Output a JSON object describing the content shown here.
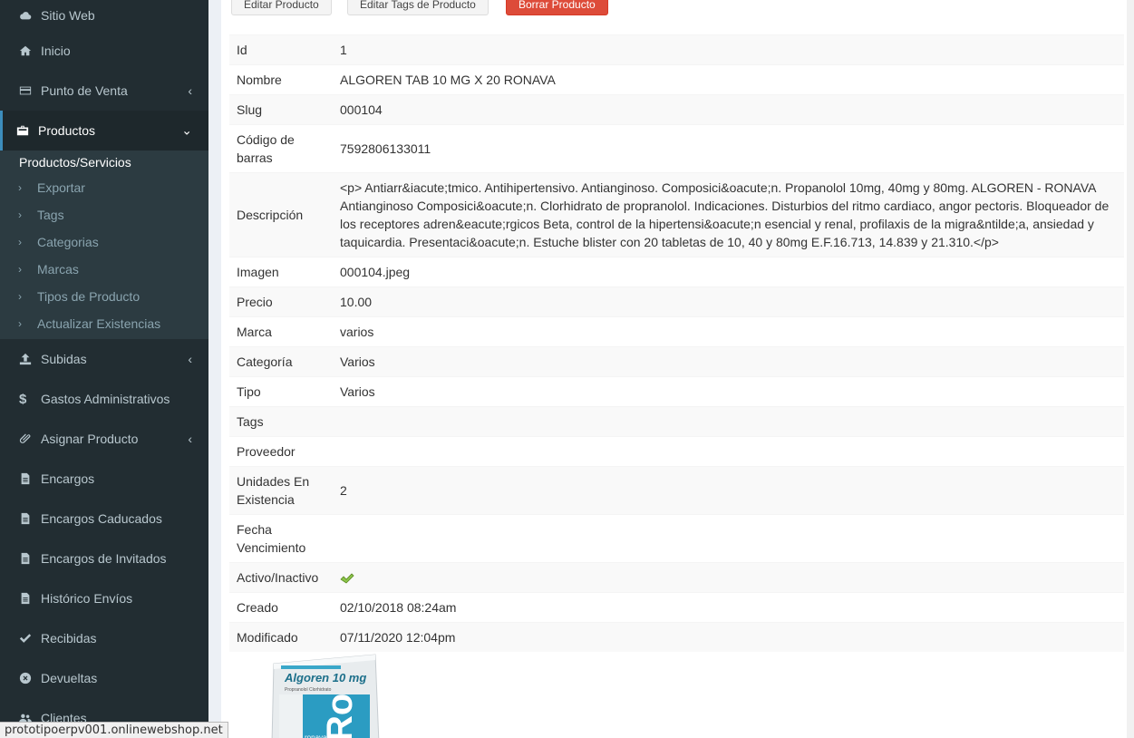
{
  "sidebar": {
    "items": [
      {
        "label": "Sitio Web",
        "icon": "cloud-icon"
      },
      {
        "label": "Inicio",
        "icon": "home-icon"
      },
      {
        "label": "Punto de Venta",
        "icon": "credit-card-icon"
      },
      {
        "label": "Productos",
        "icon": "briefcase-icon"
      },
      {
        "label": "Subidas",
        "icon": "upload-icon"
      },
      {
        "label": "Gastos Administrativos",
        "icon": "dollar-icon"
      },
      {
        "label": "Asignar Producto",
        "icon": "paperclip-icon"
      },
      {
        "label": "Encargos",
        "icon": "file-icon"
      },
      {
        "label": "Encargos Caducados",
        "icon": "file-icon"
      },
      {
        "label": "Encargos de Invitados",
        "icon": "file-icon"
      },
      {
        "label": "Histórico Envíos",
        "icon": "file-icon"
      },
      {
        "label": "Recibidas",
        "icon": "check-icon"
      },
      {
        "label": "Devueltas",
        "icon": "times-circle-icon"
      },
      {
        "label": "Clientes",
        "icon": "users-icon"
      }
    ],
    "submenu": {
      "title": "Productos/Servicios",
      "items": [
        "Exportar",
        "Tags",
        "Categorias",
        "Marcas",
        "Tipos de Producto",
        "Actualizar Existencias"
      ]
    }
  },
  "toolbar": {
    "edit_label": "Editar Producto",
    "edit_tags_label": "Editar Tags de Producto",
    "delete_label": "Borrar Producto"
  },
  "detail": {
    "rows": [
      {
        "key": "Id",
        "value": "1"
      },
      {
        "key": "Nombre",
        "value": "ALGOREN TAB 10 MG X 20 RONAVA"
      },
      {
        "key": "Slug",
        "value": "000104"
      },
      {
        "key": "Código de barras",
        "value": "7592806133011"
      },
      {
        "key": "Descripción",
        "value": "<p> Antiarr&iacute;tmico. Antihipertensivo. Antianginoso. Composici&oacute;n. Propanolol 10mg, 40mg y 80mg. ALGOREN - RONAVA Antianginoso Composici&oacute;n. Clorhidrato de propranolol. Indicaciones. Disturbios del ritmo cardiaco, angor pectoris. Bloqueador de los receptores adren&eacute;rgicos Beta, control de la hipertensi&oacute;n esencial y renal, profilaxis de la migra&ntilde;a, ansiedad y taquicardia. Presentaci&oacute;n. Estuche blister con 20 tabletas de 10, 40 y 80mg E.F.16.713, 14.839 y 21.310.</p>"
      },
      {
        "key": "Imagen",
        "value": "000104.jpeg"
      },
      {
        "key": "Precio",
        "value": "10.00"
      },
      {
        "key": "Marca",
        "value": "varios"
      },
      {
        "key": "Categoría",
        "value": "Varios"
      },
      {
        "key": "Tipo",
        "value": "Varios"
      },
      {
        "key": "Tags",
        "value": ""
      },
      {
        "key": "Proveedor",
        "value": ""
      },
      {
        "key": "Unidades En Existencia",
        "value": "2"
      },
      {
        "key": "Fecha Vencimiento",
        "value": ""
      },
      {
        "key": "Activo/Inactivo",
        "value": ""
      },
      {
        "key": "Creado",
        "value": "02/10/2018 08:24am"
      },
      {
        "key": "Modificado",
        "value": "07/11/2020 12:04pm"
      }
    ]
  },
  "product_image": {
    "brand": "Algoren 10 mg",
    "subtitle": "Propranolol Clorhidrato",
    "maker": "ronava"
  },
  "status_url": "prototipoerpv001.onlinewebshop.net"
}
